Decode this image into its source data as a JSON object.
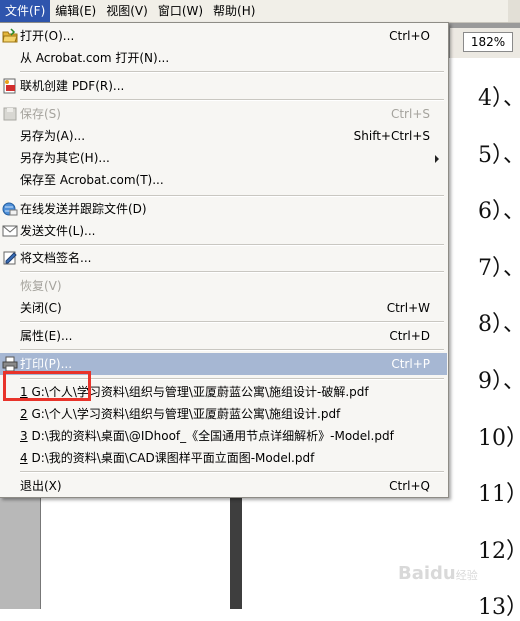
{
  "menubar": {
    "items": [
      {
        "label": "文件(F)",
        "active": true
      },
      {
        "label": "编辑(E)"
      },
      {
        "label": "视图(V)"
      },
      {
        "label": "窗口(W)"
      },
      {
        "label": "帮助(H)"
      }
    ]
  },
  "toolbar": {
    "zoom": "182%"
  },
  "file_menu": {
    "items": [
      {
        "label": "打开(O)...",
        "shortcut": "Ctrl+O",
        "icon": "open-folder-icon"
      },
      {
        "label": "从 Acrobat.com 打开(N)..."
      },
      {
        "label": "联机创建 PDF(R)...",
        "icon": "create-pdf-icon"
      },
      {
        "label": "保存(S)",
        "shortcut": "Ctrl+S",
        "icon": "save-icon"
      },
      {
        "label": "另存为(A)...",
        "shortcut": "Shift+Ctrl+S"
      },
      {
        "label": "另存为其它(H)..."
      },
      {
        "label": "保存至 Acrobat.com(T)..."
      },
      {
        "label": "在线发送并跟踪文件(D)",
        "icon": "send-track-icon"
      },
      {
        "label": "发送文件(L)...",
        "icon": "mail-icon"
      },
      {
        "label": "将文档签名...",
        "icon": "sign-icon"
      },
      {
        "label": "恢复(V)"
      },
      {
        "label": "关闭(C)",
        "shortcut": "Ctrl+W"
      },
      {
        "label": "属性(E)...",
        "shortcut": "Ctrl+D"
      },
      {
        "label": "打印(P)...",
        "shortcut": "Ctrl+P",
        "icon": "printer-icon"
      }
    ],
    "recent": [
      {
        "num": "1",
        "path": " G:\\个人\\学习资料\\组织与管理\\亚厦蔚蓝公寓\\施组设计-破解.pdf"
      },
      {
        "num": "2",
        "path": " G:\\个人\\学习资料\\组织与管理\\亚厦蔚蓝公寓\\施组设计.pdf"
      },
      {
        "num": "3",
        "path": " D:\\我的资料\\桌面\\@IDhoof_《全国通用节点详细解析》-Model.pdf"
      },
      {
        "num": "4",
        "path": " D:\\我的资料\\桌面\\CAD课图样平面立面图-Model.pdf"
      }
    ],
    "exit": {
      "label": "退出(X)",
      "shortcut": "Ctrl+Q"
    }
  },
  "document": {
    "numbers": [
      "4）、",
      "5）、",
      "6）、",
      "7）、",
      "8）、",
      "9）、",
      "10）",
      "11）",
      "12）",
      "13）"
    ]
  },
  "watermark": {
    "brand": "Baidu",
    "suffix": "经验"
  },
  "colors": {
    "menu_active": "#2f55ad",
    "highlight": "#a6b7d3",
    "annotation": "#e8332a"
  }
}
